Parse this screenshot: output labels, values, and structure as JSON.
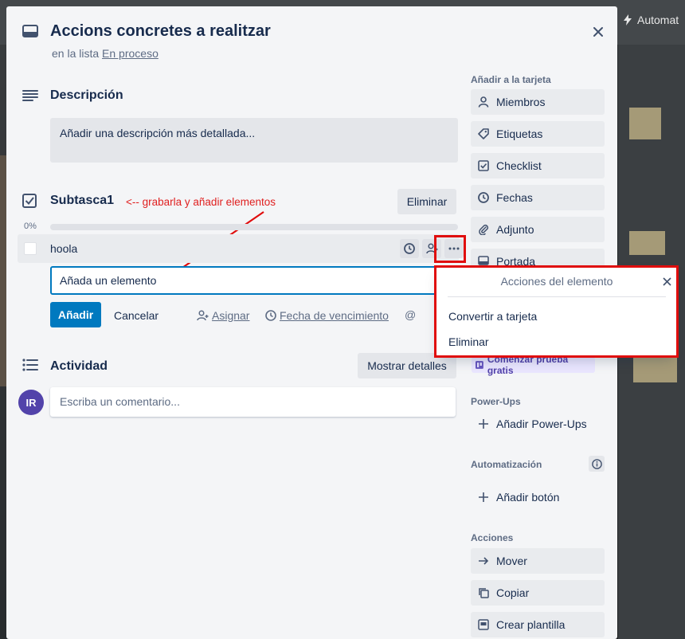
{
  "background": {
    "automation_label": "Automat"
  },
  "card": {
    "title": "Accions concretes a realitzar",
    "in_list_prefix": "en la lista",
    "list_name": "En proceso"
  },
  "description": {
    "heading": "Descripción",
    "placeholder": "Añadir una descripción más detallada..."
  },
  "checklist": {
    "title": "Subtasca1",
    "delete_label": "Eliminar",
    "progress_text": "0%",
    "progress_value": 0,
    "items": [
      {
        "label": "hoola",
        "checked": false
      }
    ],
    "new_item_value": "Añada un elemento",
    "add_label": "Añadir",
    "cancel_label": "Cancelar",
    "assign_label": "Asignar",
    "due_label": "Fecha de vencimiento",
    "mention_symbol": "@"
  },
  "annotation": {
    "text": "<-- grabarla y añadir elementos",
    "color": "#e02020"
  },
  "activity": {
    "heading": "Actividad",
    "show_details_label": "Mostrar detalles",
    "avatar_initials": "IR",
    "comment_placeholder": "Escriba un comentario..."
  },
  "sidebar": {
    "add_heading": "Añadir a la tarjeta",
    "add_items": [
      {
        "label": "Miembros",
        "icon": "person-icon"
      },
      {
        "label": "Etiquetas",
        "icon": "tag-icon"
      },
      {
        "label": "Checklist",
        "icon": "checkbox-icon"
      },
      {
        "label": "Fechas",
        "icon": "clock-icon"
      },
      {
        "label": "Adjunto",
        "icon": "paperclip-icon"
      },
      {
        "label": "Portada",
        "icon": "cover-icon"
      }
    ],
    "trial_label": "Comenzar prueba gratis",
    "powerups_heading": "Power-Ups",
    "add_powerups_label": "Añadir Power-Ups",
    "automation_heading": "Automatización",
    "add_button_label": "Añadir botón",
    "actions_heading": "Acciones",
    "actions": [
      {
        "label": "Mover",
        "icon": "arrow-right-icon"
      },
      {
        "label": "Copiar",
        "icon": "copy-icon"
      },
      {
        "label": "Crear plantilla",
        "icon": "template-icon"
      }
    ]
  },
  "item_actions_popover": {
    "title": "Acciones del elemento",
    "items": [
      "Convertir a tarjeta",
      "Eliminar"
    ]
  },
  "colors": {
    "primary": "#0079bf",
    "highlight_red": "#e00d0d",
    "avatar": "#5243aa"
  }
}
